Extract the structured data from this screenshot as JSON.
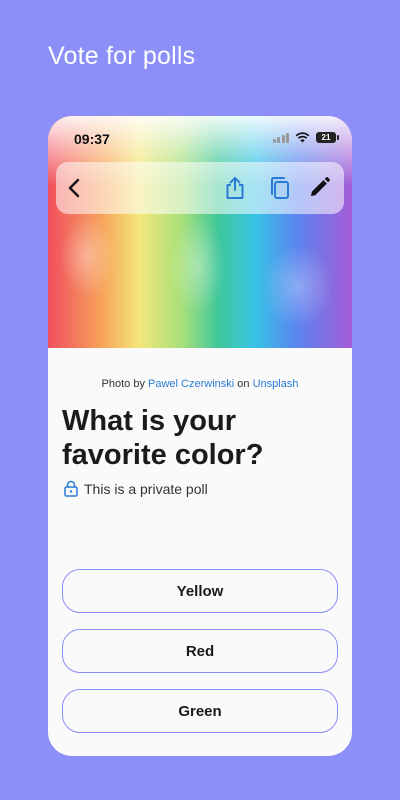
{
  "headline": "Vote for polls",
  "status_bar": {
    "time": "09:37",
    "battery": "21"
  },
  "credit": {
    "prefix": "Photo by",
    "author": "Pawel Czerwinski",
    "on": "on",
    "site": "Unsplash"
  },
  "poll": {
    "question": "What is your favorite color?",
    "privacy_label": "This is a private poll",
    "options": [
      {
        "label": "Yellow"
      },
      {
        "label": "Red"
      },
      {
        "label": "Green"
      }
    ]
  },
  "colors": {
    "accent": "#8b8ff7",
    "link": "#2a7bd6",
    "background": "#fafafa"
  },
  "icons": [
    "back-arrow-icon",
    "share-icon",
    "copy-icon",
    "edit-pencil-icon",
    "lock-icon"
  ]
}
